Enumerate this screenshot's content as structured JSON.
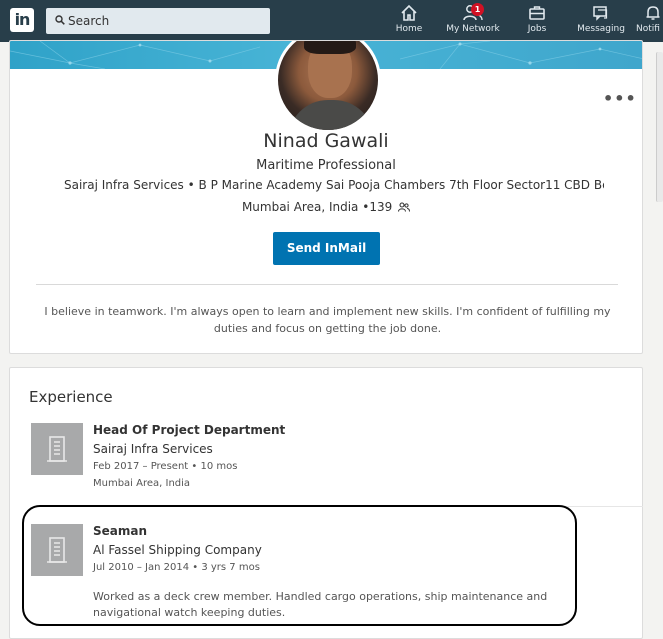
{
  "nav": {
    "logo": "in",
    "search_placeholder": "Search",
    "items": [
      {
        "label": "Home",
        "icon": "home-icon"
      },
      {
        "label": "My Network",
        "icon": "network-icon",
        "badge": "1"
      },
      {
        "label": "Jobs",
        "icon": "briefcase-icon"
      },
      {
        "label": "Messaging",
        "icon": "chat-icon"
      },
      {
        "label": "Notifi",
        "icon": "bell-icon"
      }
    ]
  },
  "profile": {
    "name": "Ninad Gawali",
    "headline": "Maritime Professional",
    "company_line": "Sairaj Infra Services • B P Marine Academy Sai Pooja Chambers 7th Floor Sector11 CBD Bela...",
    "location": "Mumbai Area, India",
    "connections": "•139",
    "inmail_button": "Send InMail",
    "more_menu": "•••",
    "summary": "I believe in teamwork. I'm always open to learn and implement new skills. I'm confident of fulfilling my duties and focus on getting the job done."
  },
  "experience": {
    "title": "Experience",
    "items": [
      {
        "title": "Head Of Project Department",
        "company": "Sairaj Infra Services",
        "dates": "Feb 2017 – Present  •  10 mos",
        "location": "Mumbai Area, India",
        "description": ""
      },
      {
        "title": "Seaman",
        "company": "Al Fassel Shipping Company",
        "dates": "Jul 2010 – Jan 2014  •  3 yrs 7 mos",
        "location": "",
        "description": "Worked as a deck crew member. Handled cargo operations, ship maintenance and navigational watch keeping duties."
      }
    ]
  },
  "colors": {
    "nav_bg": "#283e4a",
    "primary_button": "#0073b1",
    "badge": "#d11124",
    "banner": "#3fa6cc"
  }
}
